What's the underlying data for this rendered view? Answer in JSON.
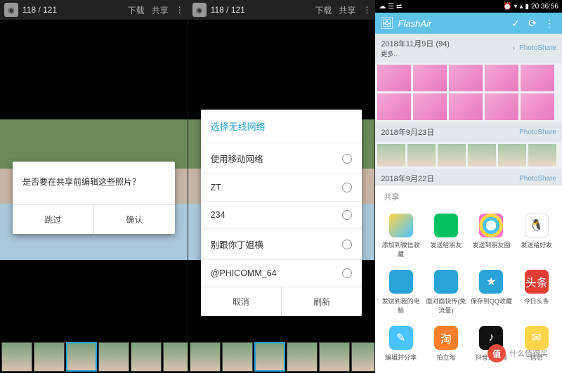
{
  "pane1": {
    "counter": "118 / 121",
    "download": "下载",
    "share": "共享",
    "dialog": {
      "message": "是否要在共享前编辑这些照片？",
      "skip": "跳过",
      "confirm": "确认"
    }
  },
  "pane2": {
    "counter": "118 / 121",
    "download": "下载",
    "share": "共享",
    "dialog": {
      "title": "选择无线网络",
      "options": [
        "使用移动网络",
        "ZT",
        "234",
        "别跟你丁姐横",
        "@PHICOMM_64"
      ],
      "cancel": "取消",
      "refresh": "刷新"
    }
  },
  "pane3": {
    "status_time": "20:36:56",
    "app_title": "FlashAir",
    "sections": [
      {
        "date": "2018年11月9日 (94)",
        "more": "更多...",
        "ps": "PhotoShare"
      },
      {
        "date": "2018年9月23日",
        "ps": "PhotoShare"
      },
      {
        "date": "2018年9月22日",
        "ps": "PhotoShare"
      }
    ],
    "share_title": "共享",
    "apps": [
      {
        "label": "添加到微信收藏",
        "cls": "c-box"
      },
      {
        "label": "发送给朋友",
        "cls": "c-wechat"
      },
      {
        "label": "发送到朋友圈",
        "cls": "c-fcircle"
      },
      {
        "label": "发送给好友",
        "cls": "c-qq",
        "glyph": "🐧"
      },
      {
        "label": "发送到我的电脑",
        "cls": "c-pc"
      },
      {
        "label": "面对面快传(免流量)",
        "cls": "c-face"
      },
      {
        "label": "保存到QQ收藏",
        "cls": "c-qqfav",
        "glyph": "★"
      },
      {
        "label": "今日头条",
        "cls": "c-toutiao",
        "glyph": "头条"
      },
      {
        "label": "编辑并分享",
        "cls": "c-edit",
        "glyph": "✎"
      },
      {
        "label": "拍立淘",
        "cls": "c-pltao",
        "glyph": "淘"
      },
      {
        "label": "抖音短视频",
        "cls": "c-douyin",
        "glyph": "♪"
      },
      {
        "label": "信息",
        "cls": "c-wb",
        "glyph": "✉"
      }
    ]
  },
  "watermark": {
    "brand": "值",
    "text": "什么值得买"
  }
}
